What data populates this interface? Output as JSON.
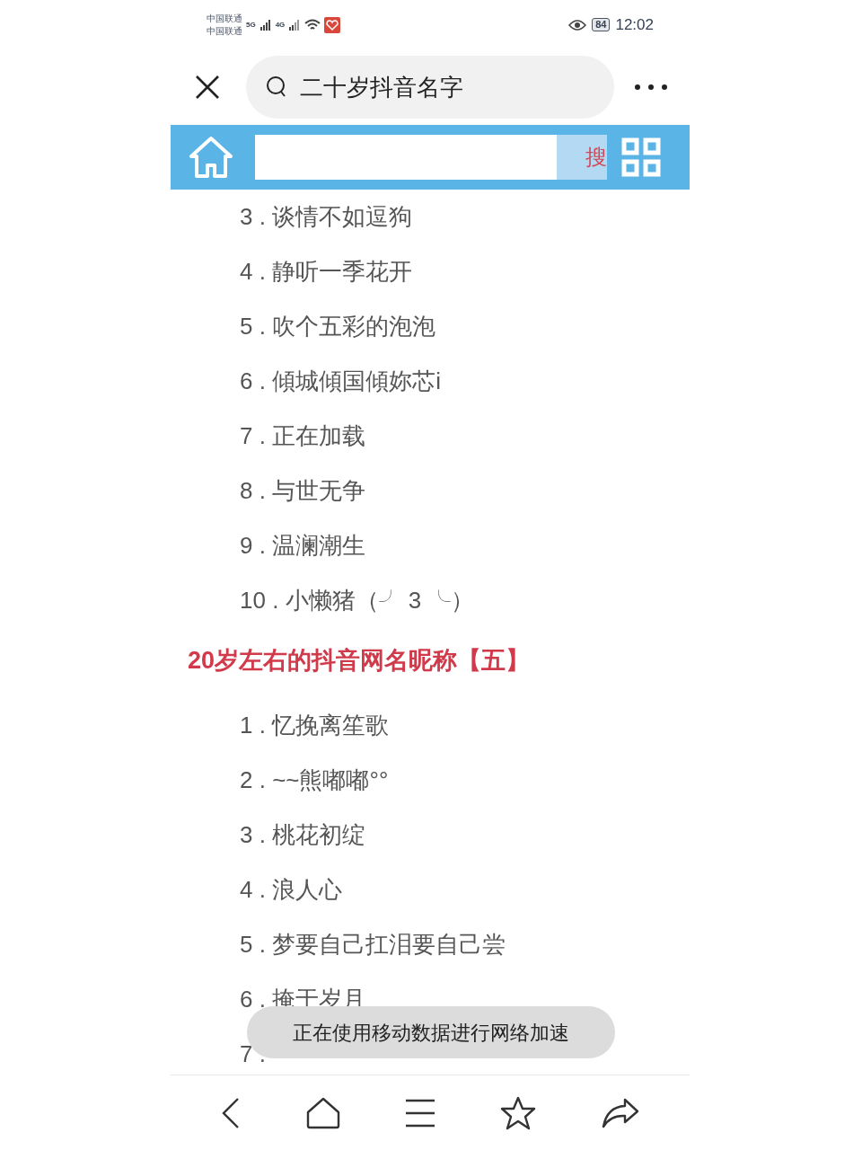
{
  "status_bar": {
    "carriers": [
      "中国联通",
      "中国联通"
    ],
    "network_labels": [
      "5G",
      "4G"
    ],
    "battery": "84",
    "time": "12:02"
  },
  "top_bar": {
    "search_text": "二十岁抖音名字"
  },
  "site_header": {
    "search_button": "搜"
  },
  "sections": [
    {
      "items": [
        "3 . 谈情不如逗狗",
        "4 . 静听一季花开",
        "5 . 吹个五彩的泡泡",
        "6 . 傾城傾国傾妳芯i",
        "7 . 正在加载",
        "8 . 与世无争",
        "9 . 温澜潮生",
        "10 . 小懒猪（╯ 3 ╰）"
      ]
    },
    {
      "heading": "20岁左右的抖音网名昵称【五】",
      "items": [
        "1 . 忆挽离笙歌",
        "2 . ~~熊嘟嘟°°",
        "3 . 桃花初绽",
        "4 . 浪人心",
        "5 . 梦要自己扛泪要自己尝",
        "6 . 掩于岁月",
        "7 ."
      ]
    }
  ],
  "toast": "正在使用移动数据进行网络加速"
}
